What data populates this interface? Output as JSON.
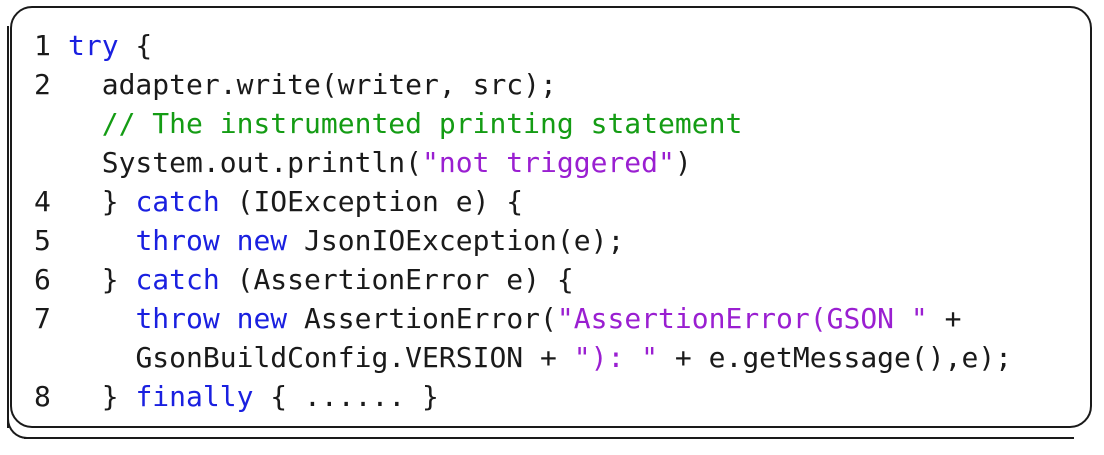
{
  "code_listing": {
    "lines": [
      {
        "num": "1",
        "segments": [
          {
            "t": "kw",
            "v": "try"
          },
          {
            "t": "txt",
            "v": " {"
          }
        ],
        "indent": ""
      },
      {
        "num": "2",
        "segments": [
          {
            "t": "txt",
            "v": "adapter.write(writer, src);"
          }
        ],
        "indent": "  "
      },
      {
        "num": "",
        "segments": [
          {
            "t": "cmt",
            "v": "// The instrumented printing statement"
          }
        ],
        "indent": "  "
      },
      {
        "num": "",
        "segments": [
          {
            "t": "txt",
            "v": "System.out.println("
          },
          {
            "t": "str",
            "v": "\"not triggered\""
          },
          {
            "t": "txt",
            "v": ")"
          }
        ],
        "indent": "  "
      },
      {
        "num": "4",
        "segments": [
          {
            "t": "txt",
            "v": "} "
          },
          {
            "t": "kw",
            "v": "catch"
          },
          {
            "t": "txt",
            "v": " (IOException e) {"
          }
        ],
        "indent": "  "
      },
      {
        "num": "5",
        "segments": [
          {
            "t": "kw",
            "v": "throw"
          },
          {
            "t": "txt",
            "v": " "
          },
          {
            "t": "kw",
            "v": "new"
          },
          {
            "t": "txt",
            "v": " JsonIOException(e);"
          }
        ],
        "indent": "    "
      },
      {
        "num": "6",
        "segments": [
          {
            "t": "txt",
            "v": "} "
          },
          {
            "t": "kw",
            "v": "catch"
          },
          {
            "t": "txt",
            "v": " (AssertionError e) {"
          }
        ],
        "indent": "  "
      },
      {
        "num": "7",
        "segments": [
          {
            "t": "kw",
            "v": "throw"
          },
          {
            "t": "txt",
            "v": " "
          },
          {
            "t": "kw",
            "v": "new"
          },
          {
            "t": "txt",
            "v": " AssertionError("
          },
          {
            "t": "str",
            "v": "\"AssertionError(GSON \""
          },
          {
            "t": "txt",
            "v": " +"
          }
        ],
        "indent": "    "
      },
      {
        "num": "",
        "segments": [
          {
            "t": "txt",
            "v": "GsonBuildConfig.VERSION + "
          },
          {
            "t": "str",
            "v": "\"): \""
          },
          {
            "t": "txt",
            "v": " + e.getMessage(),e);"
          }
        ],
        "indent": "    "
      },
      {
        "num": "8",
        "segments": [
          {
            "t": "txt",
            "v": "} "
          },
          {
            "t": "kw",
            "v": "finally"
          },
          {
            "t": "txt",
            "v": " { ...... }"
          }
        ],
        "indent": "  "
      }
    ]
  },
  "colors": {
    "keyword": "#1a20e0",
    "string": "#9a1fd1",
    "comment": "#149c14",
    "text": "#1a1a1a"
  }
}
